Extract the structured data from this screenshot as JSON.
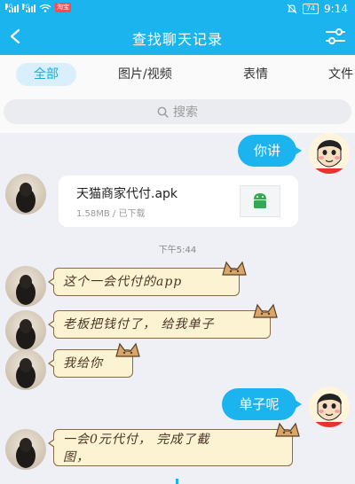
{
  "status_bar": {
    "signal1_tag": "4G",
    "signal2_tag": "2G",
    "app_badge": "淘宝",
    "battery": "74",
    "time": "9:14"
  },
  "header": {
    "title": "查找聊天记录"
  },
  "tabs": [
    {
      "label": "全部",
      "active": true
    },
    {
      "label": "图片/视频",
      "active": false
    },
    {
      "label": "表情",
      "active": false
    },
    {
      "label": "文件",
      "active": false
    }
  ],
  "search": {
    "placeholder": "搜索"
  },
  "messages": {
    "m1_self": "你讲",
    "file": {
      "name": "天猫商家代付.apk",
      "meta": "1.58MB / 已下载"
    },
    "time_divider": "下午5:44",
    "m2": "这个一会代付的app",
    "m3": "老板把钱付了， 给我单子",
    "m4": "我给你",
    "m5_self": "单子呢",
    "m6_line1": "一会0元代付， 完成了截",
    "m6_line2": "图，"
  },
  "colors": {
    "accent": "#1bb4ef",
    "tab_active_bg": "#d9f0fc",
    "note_bg": "#fbf3d2",
    "note_border": "#8a6a45"
  },
  "icons": {
    "back": "chevron-left-icon",
    "filter": "sliders-icon",
    "search": "search-icon",
    "apk": "android-icon"
  }
}
